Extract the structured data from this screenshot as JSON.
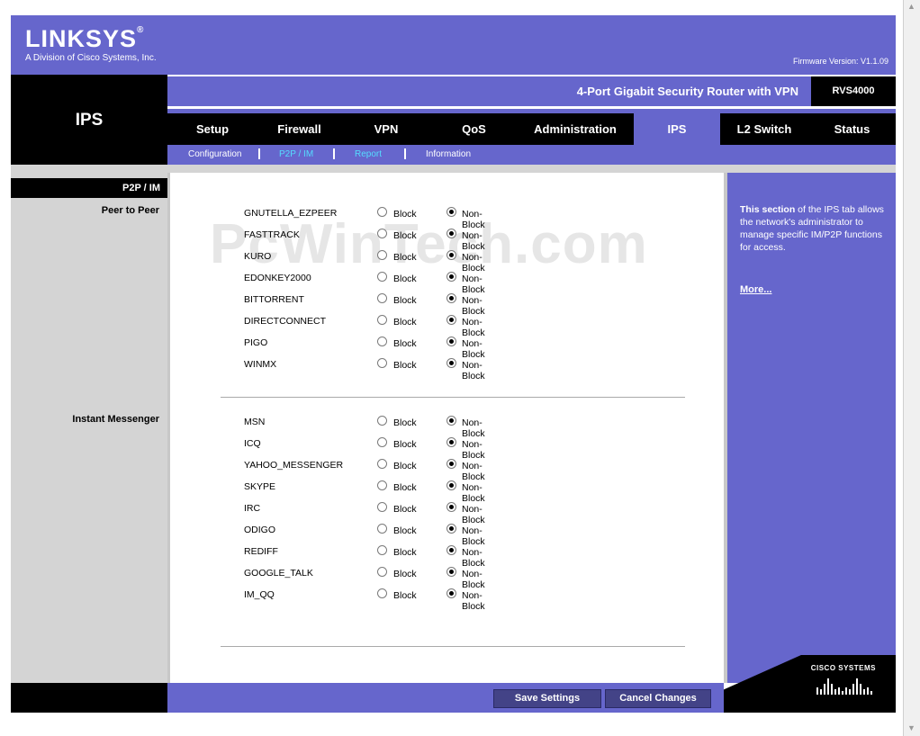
{
  "header": {
    "logo": "LINKSYS",
    "logo_reg": "®",
    "logo_sub": "A Division of Cisco Systems, Inc.",
    "firmware": "Firmware Version: V1.1.09"
  },
  "section_title": "IPS",
  "product": {
    "name": "4-Port Gigabit Security Router with VPN",
    "model": "RVS4000"
  },
  "tabs": [
    {
      "label": "Setup"
    },
    {
      "label": "Firewall"
    },
    {
      "label": "VPN"
    },
    {
      "label": "QoS"
    },
    {
      "label": "Administration"
    },
    {
      "label": "IPS"
    },
    {
      "label": "L2 Switch"
    },
    {
      "label": "Status"
    }
  ],
  "subtabs": [
    {
      "label": "Configuration"
    },
    {
      "label": "P2P / IM"
    },
    {
      "label": "Report"
    },
    {
      "label": "Information"
    }
  ],
  "left": {
    "heading": "P2P / IM",
    "p2p_label": "Peer to Peer",
    "im_label": "Instant Messenger"
  },
  "options": {
    "block": "Block",
    "nonblock": "Non-Block"
  },
  "p2p": [
    {
      "name": "GNUTELLA_EZPEER",
      "selected": "Non-Block"
    },
    {
      "name": "FASTTRACK",
      "selected": "Non-Block"
    },
    {
      "name": "KURO",
      "selected": "Non-Block"
    },
    {
      "name": "EDONKEY2000",
      "selected": "Non-Block"
    },
    {
      "name": "BITTORRENT",
      "selected": "Non-Block"
    },
    {
      "name": "DIRECTCONNECT",
      "selected": "Non-Block"
    },
    {
      "name": "PIGO",
      "selected": "Non-Block"
    },
    {
      "name": "WINMX",
      "selected": "Non-Block"
    }
  ],
  "im": [
    {
      "name": "MSN",
      "selected": "Non-Block"
    },
    {
      "name": "ICQ",
      "selected": "Non-Block"
    },
    {
      "name": "YAHOO_MESSENGER",
      "selected": "Non-Block"
    },
    {
      "name": "SKYPE",
      "selected": "Non-Block"
    },
    {
      "name": "IRC",
      "selected": "Non-Block"
    },
    {
      "name": "ODIGO",
      "selected": "Non-Block"
    },
    {
      "name": "REDIFF",
      "selected": "Non-Block"
    },
    {
      "name": "GOOGLE_TALK",
      "selected": "Non-Block"
    },
    {
      "name": "IM_QQ",
      "selected": "Non-Block"
    }
  ],
  "watermark": "PcWinTech.com",
  "help": {
    "bold": "This section",
    "text": " of the IPS tab allows the network's administrator to manage specific IM/P2P functions for access.",
    "more": "More..."
  },
  "cisco": "CISCO SYSTEMS",
  "buttons": {
    "save": "Save Settings",
    "cancel": "Cancel Changes"
  },
  "colors": {
    "brand": "#6666cc",
    "subtab_active": "#55ddff",
    "button": "#434387"
  },
  "icons": [
    "radio-icon",
    "cisco-logo-icon",
    "scroll-arrow-icon"
  ]
}
